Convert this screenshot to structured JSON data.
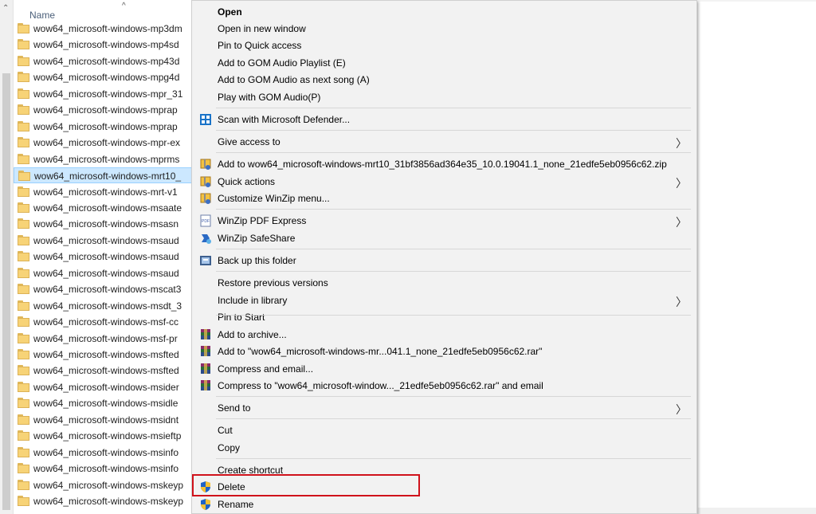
{
  "explorer": {
    "column_header": "Name",
    "sort_indicator": "^",
    "rows": [
      {
        "label": "wow64_microsoft-windows-mp3dm",
        "selected": false
      },
      {
        "label": "wow64_microsoft-windows-mp4sd",
        "selected": false
      },
      {
        "label": "wow64_microsoft-windows-mp43d",
        "selected": false
      },
      {
        "label": "wow64_microsoft-windows-mpg4d",
        "selected": false
      },
      {
        "label": "wow64_microsoft-windows-mpr_31",
        "selected": false
      },
      {
        "label": "wow64_microsoft-windows-mprap",
        "selected": false
      },
      {
        "label": "wow64_microsoft-windows-mprap",
        "selected": false
      },
      {
        "label": "wow64_microsoft-windows-mpr-ex",
        "selected": false
      },
      {
        "label": "wow64_microsoft-windows-mprms",
        "selected": false
      },
      {
        "label": "wow64_microsoft-windows-mrt10_",
        "selected": true
      },
      {
        "label": "wow64_microsoft-windows-mrt-v1",
        "selected": false
      },
      {
        "label": "wow64_microsoft-windows-msaate",
        "selected": false
      },
      {
        "label": "wow64_microsoft-windows-msasn",
        "selected": false
      },
      {
        "label": "wow64_microsoft-windows-msaud",
        "selected": false
      },
      {
        "label": "wow64_microsoft-windows-msaud",
        "selected": false
      },
      {
        "label": "wow64_microsoft-windows-msaud",
        "selected": false
      },
      {
        "label": "wow64_microsoft-windows-mscat3",
        "selected": false
      },
      {
        "label": "wow64_microsoft-windows-msdt_3",
        "selected": false
      },
      {
        "label": "wow64_microsoft-windows-msf-cc",
        "selected": false
      },
      {
        "label": "wow64_microsoft-windows-msf-pr",
        "selected": false
      },
      {
        "label": "wow64_microsoft-windows-msfted",
        "selected": false
      },
      {
        "label": "wow64_microsoft-windows-msfted",
        "selected": false
      },
      {
        "label": "wow64_microsoft-windows-msider",
        "selected": false
      },
      {
        "label": "wow64_microsoft-windows-msidle",
        "selected": false
      },
      {
        "label": "wow64_microsoft-windows-msidnt",
        "selected": false
      },
      {
        "label": "wow64_microsoft-windows-msieftp",
        "selected": false
      },
      {
        "label": "wow64_microsoft-windows-msinfo",
        "selected": false
      },
      {
        "label": "wow64_microsoft-windows-msinfo",
        "selected": false
      },
      {
        "label": "wow64_microsoft-windows-mskeyp",
        "selected": false
      },
      {
        "label": "wow64_microsoft-windows-mskeyp",
        "selected": false
      }
    ]
  },
  "context_menu": {
    "items": [
      {
        "label": "Open",
        "bold": true,
        "icon": "",
        "submenu": false
      },
      {
        "label": "Open in new window",
        "icon": "",
        "submenu": false
      },
      {
        "label": "Pin to Quick access",
        "icon": "",
        "submenu": false
      },
      {
        "label": "Add to GOM Audio Playlist (E)",
        "icon": "",
        "submenu": false
      },
      {
        "label": "Add to GOM Audio as next song (A)",
        "icon": "",
        "submenu": false
      },
      {
        "label": "Play with GOM Audio(P)",
        "icon": "",
        "submenu": false
      },
      {
        "label": "Scan with Microsoft Defender...",
        "icon": "defender-icon",
        "submenu": false
      },
      {
        "label": "Give access to",
        "icon": "",
        "submenu": true
      },
      {
        "label": "Add to wow64_microsoft-windows-mrt10_31bf3856ad364e35_10.0.19041.1_none_21edfe5eb0956c62.zip",
        "icon": "winzip-icon",
        "submenu": false
      },
      {
        "label": "Quick actions",
        "icon": "winzip-icon",
        "submenu": true
      },
      {
        "label": "Customize WinZip menu...",
        "icon": "winzip-icon",
        "submenu": false
      },
      {
        "label": "WinZip PDF Express",
        "icon": "pdf-icon",
        "submenu": true
      },
      {
        "label": "WinZip SafeShare",
        "icon": "safeshare-icon",
        "submenu": false
      },
      {
        "label": "Back up this folder",
        "icon": "backup-icon",
        "submenu": false
      },
      {
        "label": "Restore previous versions",
        "icon": "",
        "submenu": false
      },
      {
        "label": "Include in library",
        "icon": "",
        "submenu": true
      },
      {
        "label": "Pin to Start",
        "icon": "",
        "submenu": false
      },
      {
        "label": "Add to archive...",
        "icon": "winrar-icon",
        "submenu": false
      },
      {
        "label": "Add to \"wow64_microsoft-windows-mr...041.1_none_21edfe5eb0956c62.rar\"",
        "icon": "winrar-icon",
        "submenu": false
      },
      {
        "label": "Compress and email...",
        "icon": "winrar-icon",
        "submenu": false
      },
      {
        "label": "Compress to \"wow64_microsoft-window..._21edfe5eb0956c62.rar\" and email",
        "icon": "winrar-icon",
        "submenu": false
      },
      {
        "label": "Send to",
        "icon": "",
        "submenu": true
      },
      {
        "label": "Cut",
        "icon": "",
        "submenu": false
      },
      {
        "label": "Copy",
        "icon": "",
        "submenu": false
      },
      {
        "label": "Create shortcut",
        "icon": "",
        "submenu": false
      },
      {
        "label": "Delete",
        "icon": "uac-shield-icon",
        "submenu": false,
        "highlighted": true
      },
      {
        "label": "Rename",
        "icon": "uac-shield-icon",
        "submenu": false
      }
    ],
    "submenu_arrow": "〉",
    "highlight_color": "#d0121b"
  }
}
